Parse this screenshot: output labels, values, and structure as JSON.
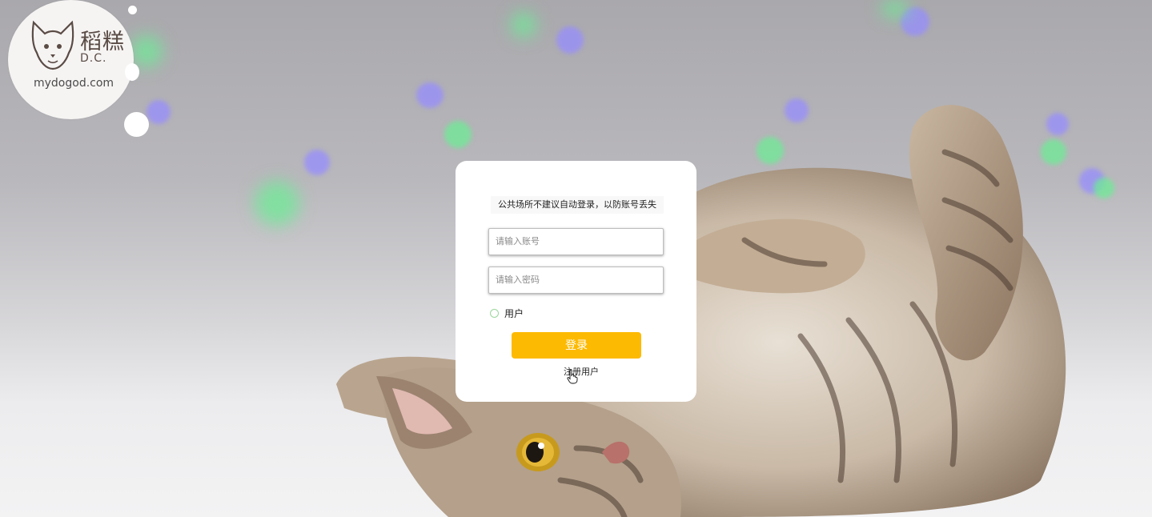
{
  "logo": {
    "brand_text": "稻糕",
    "sub_text": "D.C.",
    "url_text": "mydogod.com",
    "icon": "cat-face-icon"
  },
  "login_card": {
    "notice": "公共场所不建议自动登录，以防账号丢失",
    "account_placeholder": "请输入账号",
    "password_placeholder": "请输入密码",
    "role_option_label": "用户",
    "login_button_label": "登录",
    "register_link_label": "注册用户",
    "login_button_color": "#fdba02"
  },
  "cursor": {
    "icon": "hand-pointer-icon"
  }
}
